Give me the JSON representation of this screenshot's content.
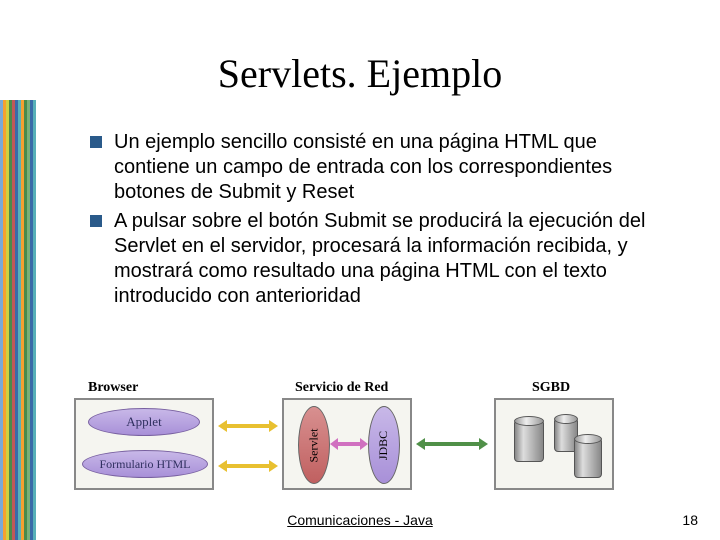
{
  "title": "Servlets.  Ejemplo",
  "bullets": [
    "Un ejemplo sencillo consisté en una página HTML que contiene un campo de entrada con los correspondientes botones de Submit y Reset",
    "A pulsar sobre el botón Submit se producirá la ejecución del Servlet en el servidor, procesará la información recibida, y mostrará como resultado una página HTML con el texto introducido con anterioridad"
  ],
  "diagram": {
    "browser": "Browser",
    "applet": "Applet",
    "form": "Formulario HTML",
    "service": "Servicio de Red",
    "servlet": "Servlet",
    "jdbc": "JDBC",
    "sgbd": "SGBD"
  },
  "footer": "Comunicaciones - Java",
  "page": "18",
  "stripes": [
    "#7aa8d8",
    "#f5a030",
    "#d0d040",
    "#4a8a4a",
    "#c05858",
    "#3a6aa8",
    "#58b0b8",
    "#f5a030",
    "#4a8a4a",
    "#78b078",
    "#3a6aa8",
    "#58b0b8"
  ]
}
